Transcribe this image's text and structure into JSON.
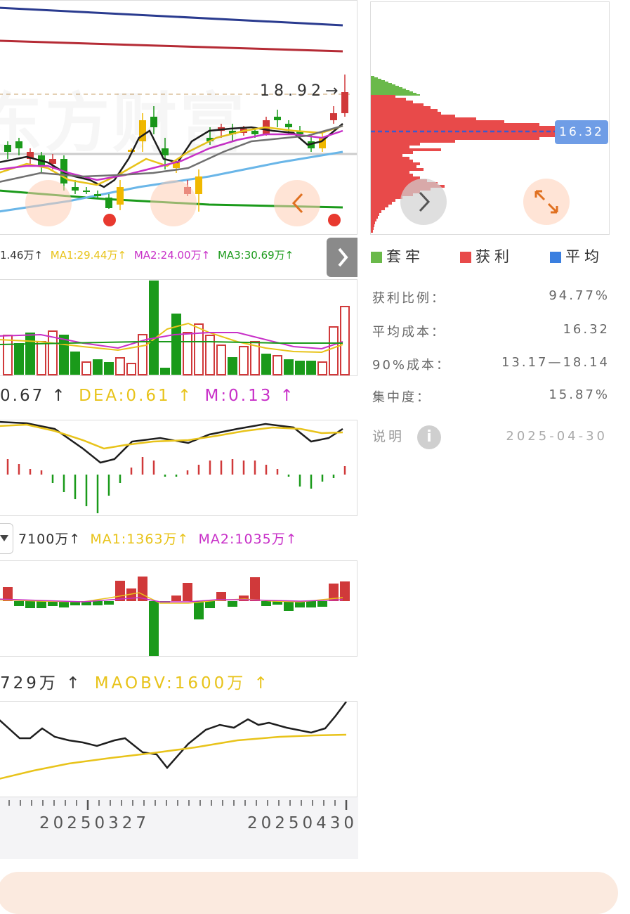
{
  "kline": {
    "price_marker": "18.92→",
    "watermark": "东方财富"
  },
  "vol_legend": {
    "vol": "1.46万↑",
    "ma1": "MA1:29.44万↑",
    "ma2": "MA2:24.00万↑",
    "ma3": "MA3:30.69万↑"
  },
  "macd_legend": {
    "dif": "0.67 ↑",
    "dea": "DEA:0.61 ↑",
    "m": "M:0.13 ↑"
  },
  "fund_legend": {
    "val": "7100万↑",
    "ma1": "MA1:1363万↑",
    "ma2": "MA2:1035万↑"
  },
  "obv_legend": {
    "obv": "729万 ↑",
    "maobv": "MAOBV:1600万 ↑"
  },
  "dates": {
    "left": "20250327",
    "right": "20250430"
  },
  "chip": {
    "avg_label": "16.32",
    "legend": {
      "trapped": "套牢",
      "profit": "获利",
      "average": "平均"
    },
    "stats": [
      {
        "label": "获利比例：",
        "value": "94.77%"
      },
      {
        "label": "平均成本：",
        "value": "16.32"
      },
      {
        "label": "90%成本：",
        "value": "13.17—18.14"
      },
      {
        "label": "集中度：",
        "value": "15.87%"
      }
    ],
    "explain_label": "说明",
    "date": "2025-04-30"
  },
  "colors": {
    "up": "#d0393a",
    "down": "#1a9a1a",
    "yellow": "#e8c31a",
    "magenta": "#c830c8",
    "blue_line": "#2a3b8f",
    "red_line": "#b52b35",
    "trapped": "#6ab94a",
    "profit": "#e84a4a",
    "average": "#3a7fe0"
  }
}
